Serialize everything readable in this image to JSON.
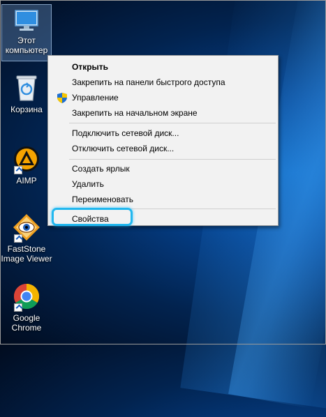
{
  "desktop": {
    "icons": [
      {
        "label": "Этот компьютер",
        "icon": "this-pc-icon",
        "selected": true
      },
      {
        "label": "Корзина",
        "icon": "recycle-bin-icon"
      },
      {
        "label": "AIMP",
        "icon": "aimp-icon"
      },
      {
        "label": "FastStone Image Viewer",
        "icon": "faststone-icon"
      },
      {
        "label": "Google Chrome",
        "icon": "chrome-icon"
      }
    ]
  },
  "context_menu": {
    "items": [
      {
        "label": "Открыть",
        "bold": true
      },
      {
        "label": "Закрепить на панели быстрого доступа"
      },
      {
        "label": "Управление",
        "icon": "shield-icon"
      },
      {
        "label": "Закрепить на начальном экране"
      },
      {
        "label": "Подключить сетевой диск..."
      },
      {
        "label": "Отключить сетевой диск..."
      },
      {
        "label": "Создать ярлык"
      },
      {
        "label": "Удалить"
      },
      {
        "label": "Переименовать"
      },
      {
        "label": "Свойства",
        "highlighted": true
      }
    ],
    "highlight_color": "#22b8ef"
  }
}
